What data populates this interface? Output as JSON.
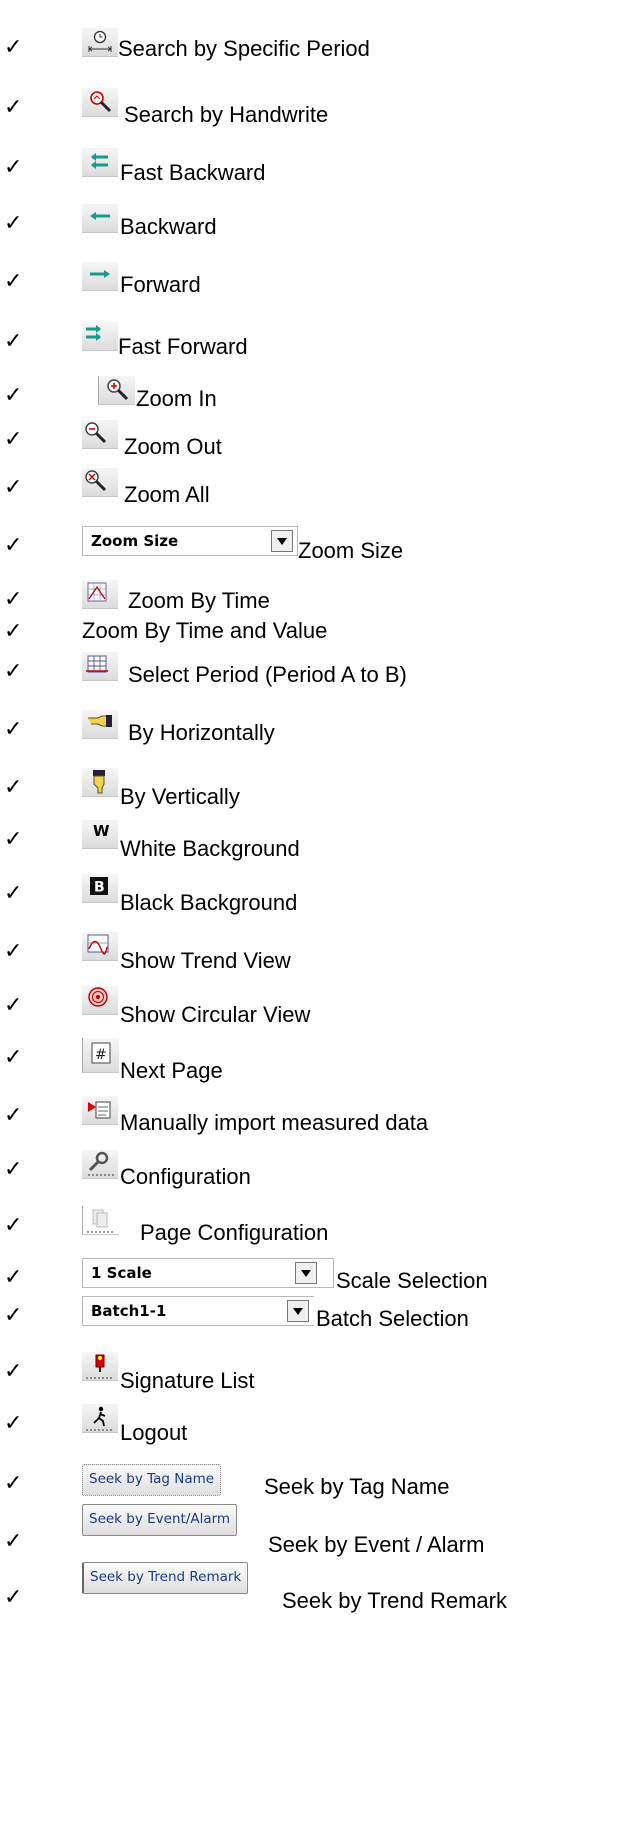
{
  "check": "✓",
  "items": [
    {
      "label": "Search by Specific Period"
    },
    {
      "label": "Search by Handwrite"
    },
    {
      "label": "Fast Backward"
    },
    {
      "label": "Backward"
    },
    {
      "label": "Forward"
    },
    {
      "label": "Fast Forward"
    },
    {
      "label": "Zoom In"
    },
    {
      "label": "Zoom Out"
    },
    {
      "label": "Zoom All"
    },
    {
      "label": "Zoom Size",
      "combo_value": "Zoom Size"
    },
    {
      "label": "Zoom By Time"
    },
    {
      "label": "Zoom By Time and Value"
    },
    {
      "label": "Select Period (Period A to B)"
    },
    {
      "label": "By Horizontally"
    },
    {
      "label": "By Vertically"
    },
    {
      "label": "White Background",
      "icon_letter": "W"
    },
    {
      "label": "Black Background",
      "icon_letter": "B"
    },
    {
      "label": "Show Trend View"
    },
    {
      "label": "Show Circular View"
    },
    {
      "label": "Next Page"
    },
    {
      "label": "Manually import measured data"
    },
    {
      "label": "Configuration"
    },
    {
      "label": "Page Configuration"
    },
    {
      "label": "Scale Selection",
      "combo_value": "1 Scale"
    },
    {
      "label": "Batch Selection",
      "combo_value": "Batch1-1"
    },
    {
      "label": "Signature List"
    },
    {
      "label": "Logout"
    },
    {
      "label": "Seek by Tag Name",
      "button_text": "Seek by Tag Name"
    },
    {
      "label": "Seek by Event / Alarm",
      "button_text": "Seek by Event/Alarm"
    },
    {
      "label": "Seek by Trend Remark",
      "button_text": "Seek by Trend Remark"
    }
  ]
}
